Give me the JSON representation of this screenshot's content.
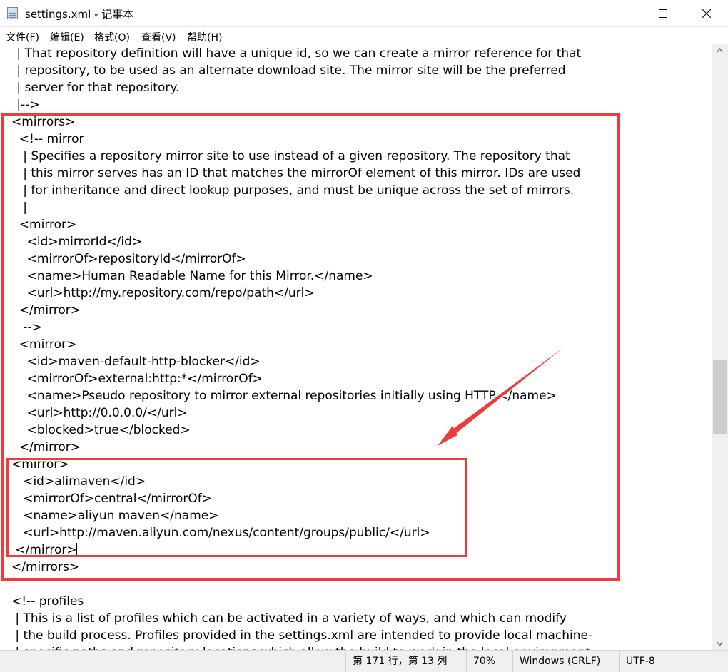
{
  "window": {
    "title": "settings.xml - 记事本",
    "icons": {
      "app": "notepad-icon",
      "minimize": "minimize-icon",
      "maximize": "maximize-icon",
      "close": "close-icon"
    }
  },
  "menu": {
    "items": [
      {
        "label": "文件(F)"
      },
      {
        "label": "编辑(E)"
      },
      {
        "label": "格式(O)"
      },
      {
        "label": "查看(V)"
      },
      {
        "label": "帮助(H)"
      }
    ]
  },
  "editor": {
    "lines": [
      " | That repository definition will have a unique id, so we can create a mirror reference for that",
      " | repository, to be used as an alternate download site. The mirror site will be the preferred",
      " | server for that repository.",
      " |-->",
      "<mirrors>",
      "  <!-- mirror",
      "   | Specifies a repository mirror site to use instead of a given repository. The repository that",
      "   | this mirror serves has an ID that matches the mirrorOf element of this mirror. IDs are used",
      "   | for inheritance and direct lookup purposes, and must be unique across the set of mirrors.",
      "   |",
      "  <mirror>",
      "    <id>mirrorId</id>",
      "    <mirrorOf>repositoryId</mirrorOf>",
      "    <name>Human Readable Name for this Mirror.</name>",
      "    <url>http://my.repository.com/repo/path</url>",
      "  </mirror>",
      "   -->",
      "  <mirror>",
      "    <id>maven-default-http-blocker</id>",
      "    <mirrorOf>external:http:*</mirrorOf>",
      "    <name>Pseudo repository to mirror external repositories initially using HTTP.</name>",
      "    <url>http://0.0.0.0/</url>",
      "    <blocked>true</blocked>",
      "  </mirror>",
      "<mirror>",
      "   <id>alimaven</id>",
      "   <mirrorOf>central</mirrorOf>",
      "   <name>aliyun maven</name>",
      "   <url>http://maven.aliyun.com/nexus/content/groups/public/</url>",
      " </mirror>",
      "</mirrors>",
      "",
      "<!-- profiles",
      " | This is a list of profiles which can be activated in a variety of ways, and which can modify",
      " | the build process. Profiles provided in the settings.xml are intended to provide local machine-",
      " | specific paths and repository locations which allow the build to work in the local environment."
    ]
  },
  "status": {
    "position": "第 171 行，第 13 列",
    "zoom": "70%",
    "line_ending": "Windows (CRLF)",
    "encoding": "UTF-8"
  },
  "annotation_color": "#ef3b3b"
}
